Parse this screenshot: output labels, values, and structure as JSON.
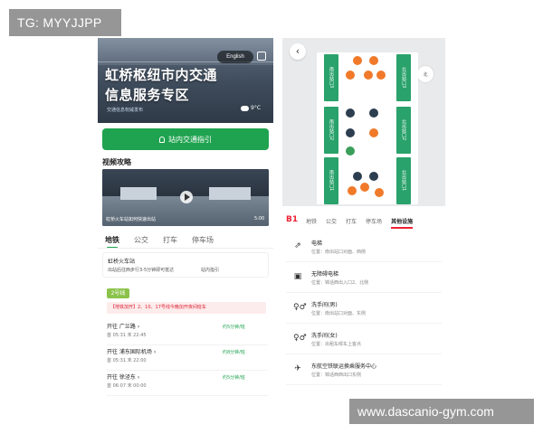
{
  "watermarks": {
    "top_left": "TG: MYYJJPP",
    "bottom_right": "www.dascanio-gym.com"
  },
  "left_phone": {
    "hero": {
      "title_line1": "虹桥枢纽市内交通",
      "title_line2": "信息服务专区",
      "subtitle": "交通信息权威发布",
      "language_button": "English",
      "weather": "9°C"
    },
    "guide_button": "站内交通指引",
    "video_section": {
      "title": "视频攻略",
      "caption": "虹桥火车站如何快速出站",
      "duration": "5:00"
    },
    "tabs": [
      "地铁",
      "公交",
      "打车",
      "停车场"
    ],
    "active_tab": "地铁",
    "station": {
      "name": "虹桥火车站",
      "distance": "出站后往西步行3-5分钟即可抵达",
      "guide_link": "站内指引"
    },
    "line_badge": "2号线",
    "notice": "【地铁加开】2、10、17号线今晚加开夜间班车",
    "directions": [
      {
        "to": "开往 广兰路 ›",
        "times": "首 05:31  末 22:45",
        "interval": "约5分钟/班"
      },
      {
        "to": "开往 浦东国际机场 ›",
        "times": "首 05:31  末 22:00",
        "interval": "约8分钟/班"
      },
      {
        "to": "开往 徐泾东 ›",
        "times": "首 06:07  末 00:00",
        "interval": "约5分钟/班"
      }
    ]
  },
  "right_phone": {
    "back_icon": "back-arrow-icon",
    "compass_label": "北",
    "map_exits": [
      "北出站口3",
      "北出站口2",
      "北出站口1",
      "南出站口3",
      "南出站口2",
      "南出站口1"
    ],
    "floor": "B1",
    "tabs": [
      "地铁",
      "公交",
      "打车",
      "停车场",
      "其他设施"
    ],
    "active_tab": "其他设施",
    "facilities": [
      {
        "icon": "escalator-icon",
        "glyph": "⇗",
        "name": "电梯",
        "location": "位置：南出站口对面、西侧"
      },
      {
        "icon": "accessible-elevator-icon",
        "glyph": "▣",
        "name": "无障碍电梯",
        "location": "位置：锦话西出入口2、北侧"
      },
      {
        "icon": "restroom-icon",
        "glyph": "♀♂",
        "name": "洗手间(男)",
        "location": "位置：南出站口对面、东侧"
      },
      {
        "icon": "restroom-icon",
        "glyph": "♀♂",
        "name": "洗手间(女)",
        "location": "位置：出租车候车上客点"
      },
      {
        "icon": "airplane-icon",
        "glyph": "✈",
        "name": "东航空铁联运换乘服务中心",
        "location": "位置：锦话西西出口东侧"
      }
    ]
  }
}
